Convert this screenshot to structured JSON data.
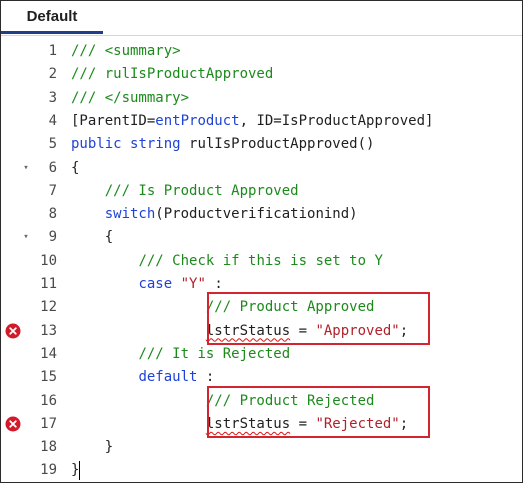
{
  "tab": {
    "label": "Default"
  },
  "lines": [
    {
      "num": "1",
      "indent": "",
      "parts": [
        {
          "t": "/// <summary>",
          "c": "comment"
        }
      ]
    },
    {
      "num": "2",
      "indent": "",
      "parts": [
        {
          "t": "/// rulIsProductApproved",
          "c": "comment"
        }
      ]
    },
    {
      "num": "3",
      "indent": "",
      "parts": [
        {
          "t": "/// </summary>",
          "c": "comment"
        }
      ]
    },
    {
      "num": "4",
      "indent": "",
      "parts": [
        {
          "t": "[ParentID=",
          "c": "plain"
        },
        {
          "t": "entProduct",
          "c": "param"
        },
        {
          "t": ", ID=IsProductApproved]",
          "c": "plain"
        }
      ]
    },
    {
      "num": "5",
      "indent": "",
      "parts": [
        {
          "t": "public",
          "c": "key"
        },
        {
          "t": " ",
          "c": "plain"
        },
        {
          "t": "string",
          "c": "key"
        },
        {
          "t": " rulIsProductApproved()",
          "c": "plain"
        }
      ]
    },
    {
      "num": "6",
      "indent": "",
      "fold": true,
      "parts": [
        {
          "t": "{",
          "c": "plain"
        }
      ]
    },
    {
      "num": "7",
      "indent": "    ",
      "parts": [
        {
          "t": "/// Is Product Approved",
          "c": "comment"
        }
      ]
    },
    {
      "num": "8",
      "indent": "    ",
      "parts": [
        {
          "t": "switch",
          "c": "key"
        },
        {
          "t": "(Productverificationind)",
          "c": "plain"
        }
      ]
    },
    {
      "num": "9",
      "indent": "    ",
      "fold": true,
      "parts": [
        {
          "t": "{",
          "c": "plain"
        }
      ]
    },
    {
      "num": "10",
      "indent": "        ",
      "parts": [
        {
          "t": "/// Check if this is set to Y",
          "c": "comment"
        }
      ]
    },
    {
      "num": "11",
      "indent": "        ",
      "parts": [
        {
          "t": "case",
          "c": "key"
        },
        {
          "t": " ",
          "c": "plain"
        },
        {
          "t": "\"Y\"",
          "c": "str"
        },
        {
          "t": " :",
          "c": "plain"
        }
      ]
    },
    {
      "num": "12",
      "indent": "                ",
      "parts": [
        {
          "t": "/// Product Approved",
          "c": "comment"
        }
      ]
    },
    {
      "num": "13",
      "indent": "                ",
      "error": true,
      "parts": [
        {
          "t": "lstrStatus",
          "c": "plain",
          "squiggle": true
        },
        {
          "t": " = ",
          "c": "plain"
        },
        {
          "t": "\"Approved\"",
          "c": "str"
        },
        {
          "t": ";",
          "c": "plain"
        }
      ]
    },
    {
      "num": "14",
      "indent": "        ",
      "parts": [
        {
          "t": "/// It is Rejected",
          "c": "comment"
        }
      ]
    },
    {
      "num": "15",
      "indent": "        ",
      "parts": [
        {
          "t": "default",
          "c": "key"
        },
        {
          "t": " :",
          "c": "plain"
        }
      ]
    },
    {
      "num": "16",
      "indent": "                ",
      "parts": [
        {
          "t": "/// Product Rejected",
          "c": "comment"
        }
      ]
    },
    {
      "num": "17",
      "indent": "                ",
      "error": true,
      "parts": [
        {
          "t": "lstrStatus",
          "c": "plain",
          "squiggle": true
        },
        {
          "t": " = ",
          "c": "plain"
        },
        {
          "t": "\"Rejected\"",
          "c": "str"
        },
        {
          "t": ";",
          "c": "plain"
        }
      ]
    },
    {
      "num": "18",
      "indent": "    ",
      "parts": [
        {
          "t": "}",
          "c": "plain"
        }
      ]
    },
    {
      "num": "19",
      "indent": "",
      "parts": [
        {
          "t": "}",
          "c": "plain"
        }
      ]
    }
  ],
  "colors": {
    "comment": "#1c8a1c",
    "keyword": "#1f42d6",
    "string": "#b3202a",
    "highlight_box": "#d2252f",
    "error_icon": "#d11a2a",
    "tab_underline": "#1f3f8a"
  },
  "icons": {
    "error": "error-x-icon",
    "fold": "fold-arrow-icon"
  }
}
